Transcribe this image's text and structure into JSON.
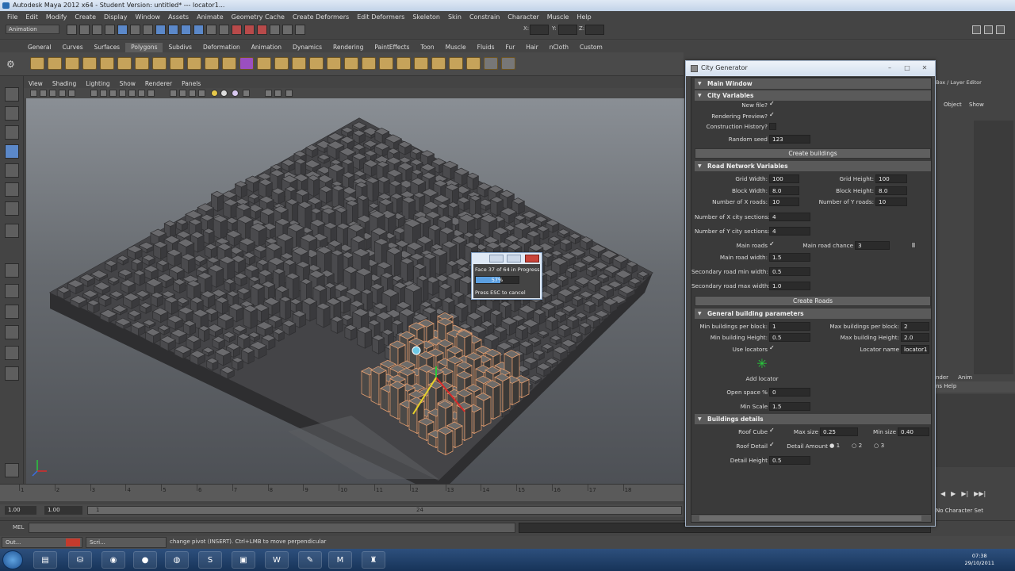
{
  "window": {
    "title": "Autodesk Maya 2012 x64 - Student Version: untitled*   ---   locator1..."
  },
  "menus": [
    "File",
    "Edit",
    "Modify",
    "Create",
    "Display",
    "Window",
    "Assets",
    "Animate",
    "Geometry Cache",
    "Create Deformers",
    "Edit Deformers",
    "Skeleton",
    "Skin",
    "Constrain",
    "Character",
    "Muscle",
    "Help"
  ],
  "status": {
    "mode": "Animation",
    "x_label": "X:",
    "y_label": "Y:",
    "z_label": "Z:"
  },
  "shelf_tabs": [
    "General",
    "Curves",
    "Surfaces",
    "Polygons",
    "Subdivs",
    "Deformation",
    "Animation",
    "Dynamics",
    "Rendering",
    "PaintEffects",
    "Toon",
    "Muscle",
    "Fluids",
    "Fur",
    "Hair",
    "nCloth",
    "Custom"
  ],
  "shelf_active": "Polygons",
  "viewport_menu": [
    "View",
    "Shading",
    "Lighting",
    "Show",
    "Renderer",
    "Panels"
  ],
  "timeline": {
    "ticks": [
      "1",
      "2",
      "3",
      "4",
      "5",
      "6",
      "7",
      "8",
      "9",
      "10",
      "11",
      "12",
      "13",
      "14",
      "15",
      "16",
      "17",
      "18"
    ],
    "start": "1.00",
    "start2": "1.00",
    "slider_start": "1",
    "slider_end": "24"
  },
  "command_line": {
    "label": "MEL"
  },
  "help_line": {
    "text": "change pivot (INSERT).  Ctrl+LMB to move perpendicular",
    "windows": [
      "Out...",
      "Scri..."
    ]
  },
  "progress": {
    "message": "Face 37 of 64 in Progress",
    "percent_text": "57%",
    "percent": 57,
    "cancel_hint": "Press ESC to cancel"
  },
  "right_panel": {
    "title": "Box / Layer Editor",
    "menu": [
      "Object",
      "Show"
    ],
    "tabs": [
      "nder",
      "Anim"
    ],
    "bar_label": "ns   Help",
    "character": "No Character Set"
  },
  "taskbar": {
    "time": "07:38",
    "date": "29/10/2011"
  },
  "city_generator": {
    "title": "City Generator",
    "sections": {
      "main": "Main Window",
      "city": "City Variables",
      "road": "Road Network Variables",
      "building": "General building parameters",
      "details": "Buildings details"
    },
    "city_vars": {
      "new_file_label": "New file?",
      "rendering_preview_label": "Rendering Preview?",
      "construction_history_label": "Construction History?",
      "random_seed_label": "Random seed",
      "random_seed": "123",
      "check": "✓"
    },
    "create_buildings": "Create buildings",
    "road_vars": {
      "grid_width_label": "Grid Width:",
      "grid_width": "100",
      "grid_height_label": "Grid Height:",
      "grid_height": "100",
      "block_width_label": "Block Width:",
      "block_width": "8.0",
      "block_height_label": "Block Height:",
      "block_height": "8.0",
      "num_x_roads_label": "Number of X roads:",
      "num_x_roads": "10",
      "num_y_roads_label": "Number of Y roads:",
      "num_y_roads": "10",
      "x_sections_label": "Number of X city sections:",
      "x_sections": "4",
      "y_sections_label": "Number of Y city sections:",
      "y_sections": "4",
      "main_roads_label": "Main roads",
      "main_road_chance_label": "Main road chance",
      "main_road_chance": "3",
      "main_road_width_label": "Main road width:",
      "main_road_width": "1.5",
      "sec_min_label": "Secondary road min width:",
      "sec_min": "0.5",
      "sec_max_label": "Secondary road max width:",
      "sec_max": "1.0"
    },
    "create_roads": "Create Roads",
    "building_params": {
      "min_per_block_label": "Min buildings per block:",
      "min_per_block": "1",
      "max_per_block_label": "Max buildings per block:",
      "max_per_block": "2",
      "min_height_label": "Min building Height:",
      "min_height": "0.5",
      "max_height_label": "Max building Height:",
      "max_height": "2.0",
      "use_locators_label": "Use locators",
      "locator_name_label": "Locator name",
      "locator_name": "locator1",
      "add_locator": "Add locator",
      "open_space_label": "Open space %",
      "open_space": "0",
      "min_scale_label": "Min Scale",
      "min_scale": "1.5"
    },
    "details": {
      "roof_cube_label": "Roof Cube",
      "max_size_label": "Max size",
      "max_size": "0.25",
      "min_size_label": "Min size",
      "min_size": "0.40",
      "roof_detail_label": "Roof Detail",
      "detail_amount_label": "Detail Amount",
      "amount_options": [
        "1",
        "2",
        "3"
      ],
      "detail_height_label": "Detail Height",
      "detail_height": "0.5"
    }
  },
  "colors": {
    "maya_bg": "#444444",
    "selection_orange": "#e8a070",
    "progress_blue": "#5b9fe0"
  }
}
